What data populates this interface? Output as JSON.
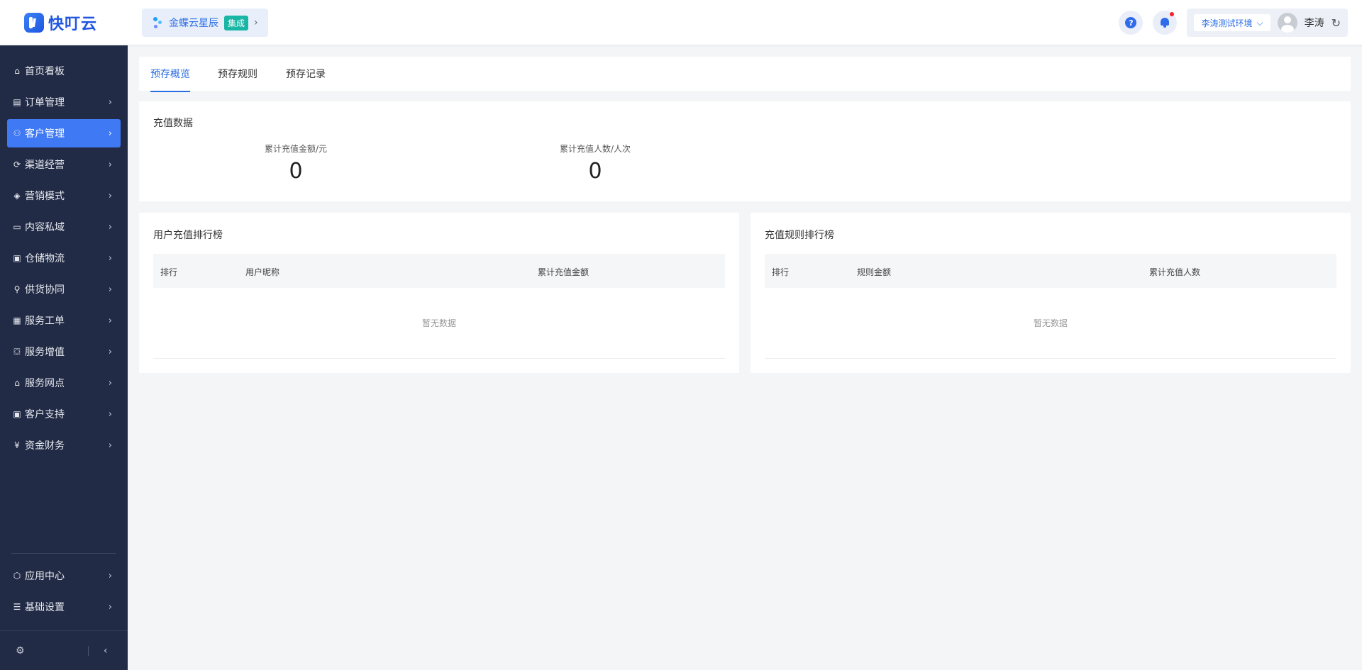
{
  "header": {
    "logo_text": "快叮云",
    "brand": {
      "name": "金蝶云星辰",
      "tag": "集成",
      "arrow": "›"
    },
    "help_label": "?",
    "env": {
      "label": "李涛测试环境",
      "arrow": "⌵"
    },
    "user_name": "李涛",
    "refresh_icon": "↻"
  },
  "sidebar": {
    "items": [
      {
        "label": "首页看板",
        "icon": "⌂",
        "name": "home-icon"
      },
      {
        "label": "订单管理",
        "icon": "▤",
        "name": "order-icon"
      },
      {
        "label": "客户管理",
        "icon": "⚇",
        "name": "customer-icon",
        "active": true
      },
      {
        "label": "渠道经营",
        "icon": "⟳",
        "name": "channel-icon"
      },
      {
        "label": "营销模式",
        "icon": "◈",
        "name": "tag-icon"
      },
      {
        "label": "内容私域",
        "icon": "▭",
        "name": "image-icon"
      },
      {
        "label": "仓储物流",
        "icon": "▣",
        "name": "warehouse-icon"
      },
      {
        "label": "供货协同",
        "icon": "⚲",
        "name": "supply-icon"
      },
      {
        "label": "服务工单",
        "icon": "▦",
        "name": "workorder-icon"
      },
      {
        "label": "服务增值",
        "icon": "⛋",
        "name": "bag-icon"
      },
      {
        "label": "服务网点",
        "icon": "⌂",
        "name": "store-icon"
      },
      {
        "label": "客户支持",
        "icon": "▣",
        "name": "support-icon"
      },
      {
        "label": "资金财务",
        "icon": "¥",
        "name": "finance-icon"
      }
    ],
    "bottom_items": [
      {
        "label": "应用中心",
        "icon": "⬡",
        "name": "app-center-icon"
      },
      {
        "label": "基础设置",
        "icon": "☰",
        "name": "settings-icon"
      }
    ],
    "chevron": "›",
    "footer": {
      "gear": "⚙",
      "collapse": "‹"
    }
  },
  "tabs": [
    {
      "label": "预存概览",
      "active": true
    },
    {
      "label": "预存规则"
    },
    {
      "label": "预存记录"
    }
  ],
  "recharge": {
    "title": "充值数据",
    "stats": [
      {
        "label": "累计充值金额/元",
        "value": "0"
      },
      {
        "label": "累计充值人数/人次",
        "value": "0"
      }
    ]
  },
  "user_rank": {
    "title": "用户充值排行榜",
    "columns": [
      "排行",
      "用户昵称",
      "累计充值金额"
    ],
    "empty": "暂无数据"
  },
  "rule_rank": {
    "title": "充值规则排行榜",
    "columns": [
      "排行",
      "规则金额",
      "累计充值人数"
    ],
    "empty": "暂无数据"
  },
  "colors": {
    "primary": "#2b6de5",
    "sidebar_bg": "#222b45",
    "active_bg": "#3f79f4",
    "tag": "#19b5a5"
  }
}
